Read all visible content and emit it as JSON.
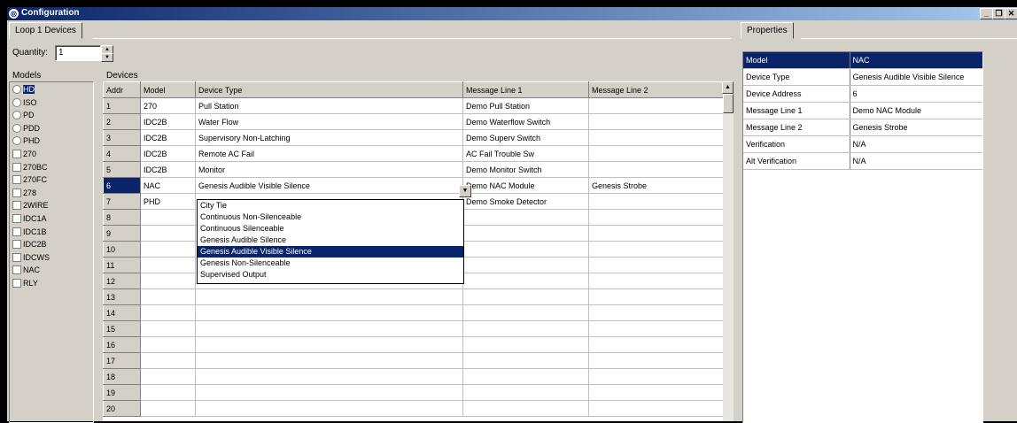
{
  "window": {
    "title": "Configuration",
    "minimize": "_",
    "restore": "❐",
    "close": "✕"
  },
  "left_tab": "Loop 1 Devices",
  "quantity": {
    "label": "Quantity:",
    "value": "1"
  },
  "models": {
    "label": "Models",
    "items": [
      {
        "label": "HD",
        "kind": "radio",
        "selected": true
      },
      {
        "label": "ISO",
        "kind": "radio"
      },
      {
        "label": "PD",
        "kind": "radio"
      },
      {
        "label": "PDD",
        "kind": "radio"
      },
      {
        "label": "PHD",
        "kind": "radio"
      },
      {
        "label": "270",
        "kind": "check"
      },
      {
        "label": "270BC",
        "kind": "check"
      },
      {
        "label": "270FC",
        "kind": "check"
      },
      {
        "label": "278",
        "kind": "check"
      },
      {
        "label": "2WIRE",
        "kind": "check"
      },
      {
        "label": "IDC1A",
        "kind": "check"
      },
      {
        "label": "IDC1B",
        "kind": "check"
      },
      {
        "label": "IDC2B",
        "kind": "check"
      },
      {
        "label": "IDCWS",
        "kind": "check"
      },
      {
        "label": "NAC",
        "kind": "check"
      },
      {
        "label": "RLY",
        "kind": "check"
      }
    ]
  },
  "devices": {
    "label": "Devices",
    "columns": [
      "Addr",
      "Model",
      "Device Type",
      "Message Line 1",
      "Message Line 2"
    ],
    "rows": [
      [
        "1",
        "270",
        "Pull Station",
        "Demo Pull Station",
        ""
      ],
      [
        "2",
        "IDC2B",
        "Water Flow",
        "Demo Waterflow Switch",
        ""
      ],
      [
        "3",
        "IDC2B",
        "Supervisory Non-Latching",
        "Demo Superv Switch",
        ""
      ],
      [
        "4",
        "IDC2B",
        "Remote AC Fail",
        "AC Fail Trouble Sw",
        ""
      ],
      [
        "5",
        "IDC2B",
        "Monitor",
        "Demo Monitor Switch",
        ""
      ],
      [
        "6",
        "NAC",
        "Genesis Audible Visible Silence",
        "Demo NAC Module",
        "Genesis Strobe"
      ],
      [
        "7",
        "PHD",
        "",
        "Demo Smoke Detector",
        ""
      ],
      [
        "8",
        "",
        "",
        "",
        ""
      ],
      [
        "9",
        "",
        "",
        "",
        ""
      ],
      [
        "10",
        "",
        "",
        "",
        ""
      ],
      [
        "11",
        "",
        "",
        "",
        ""
      ],
      [
        "12",
        "",
        "",
        "",
        ""
      ],
      [
        "13",
        "",
        "",
        "",
        ""
      ],
      [
        "14",
        "",
        "",
        "",
        ""
      ],
      [
        "15",
        "",
        "",
        "",
        ""
      ],
      [
        "16",
        "",
        "",
        "",
        ""
      ],
      [
        "17",
        "",
        "",
        "",
        ""
      ],
      [
        "18",
        "",
        "",
        "",
        ""
      ],
      [
        "19",
        "",
        "",
        "",
        ""
      ],
      [
        "20",
        "",
        "",
        "",
        ""
      ]
    ],
    "selected_addr": "6"
  },
  "dropdown": {
    "options": [
      "City Tie",
      "Continuous Non-Silenceable",
      "Continuous Silenceable",
      "Genesis Audible Silence",
      "Genesis Audible Visible Silence",
      "Genesis Non-Silenceable",
      "Supervised Output"
    ],
    "highlighted": "Genesis Audible Visible Silence"
  },
  "properties": {
    "tab": "Properties",
    "rows": [
      [
        "Model",
        "NAC"
      ],
      [
        "Device Type",
        "Genesis Audible Visible Silence"
      ],
      [
        "Device Address",
        "6"
      ],
      [
        "Message Line 1",
        "Demo NAC Module"
      ],
      [
        "Message Line 2",
        "Genesis Strobe"
      ],
      [
        "Verification",
        "N/A"
      ],
      [
        "Alt Verification",
        "N/A"
      ]
    ]
  }
}
